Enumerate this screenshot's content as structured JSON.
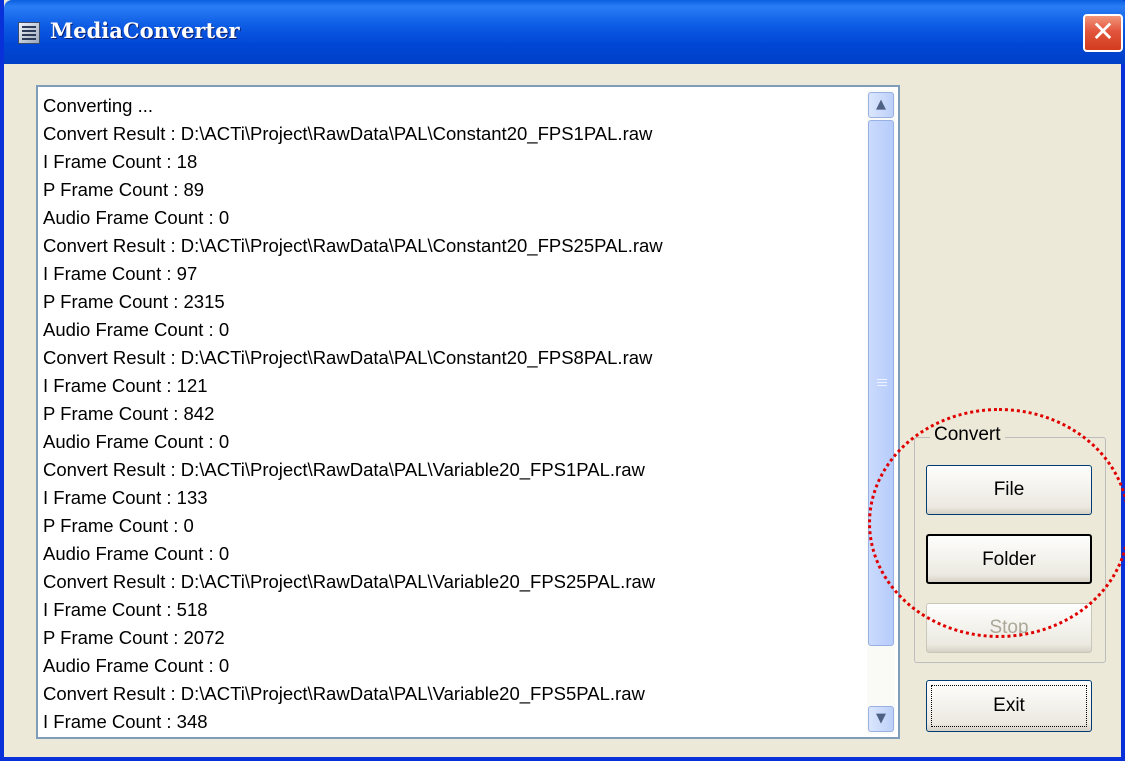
{
  "window": {
    "title": "MediaConverter",
    "close_glyph": "✕"
  },
  "log": {
    "lines": [
      "Converting ...",
      "Convert Result : D:\\ACTi\\Project\\RawData\\PAL\\Constant20_FPS1PAL.raw",
      "I Frame Count : 18",
      "P Frame Count : 89",
      "Audio Frame Count : 0",
      "Convert Result : D:\\ACTi\\Project\\RawData\\PAL\\Constant20_FPS25PAL.raw",
      "I Frame Count : 97",
      "P Frame Count : 2315",
      "Audio Frame Count : 0",
      "Convert Result : D:\\ACTi\\Project\\RawData\\PAL\\Constant20_FPS8PAL.raw",
      "I Frame Count : 121",
      "P Frame Count : 842",
      "Audio Frame Count : 0",
      "Convert Result : D:\\ACTi\\Project\\RawData\\PAL\\Variable20_FPS1PAL.raw",
      "I Frame Count : 133",
      "P Frame Count : 0",
      "Audio Frame Count : 0",
      "Convert Result : D:\\ACTi\\Project\\RawData\\PAL\\Variable20_FPS25PAL.raw",
      "I Frame Count : 518",
      "P Frame Count : 2072",
      "Audio Frame Count : 0",
      "Convert Result : D:\\ACTi\\Project\\RawData\\PAL\\Variable20_FPS5PAL.raw",
      "I Frame Count : 348"
    ]
  },
  "convert_group": {
    "label": "Convert",
    "file_label": "File",
    "folder_label": "Folder",
    "stop_label": "Stop"
  },
  "exit_label": "Exit",
  "colors": {
    "titlebar": "#0046d5",
    "highlight": "#e00000",
    "disabled_text": "#aca899"
  },
  "icons": {
    "app": "app-icon",
    "close": "close-icon",
    "scroll_up": "chevron-up-icon",
    "scroll_down": "chevron-down-icon"
  }
}
